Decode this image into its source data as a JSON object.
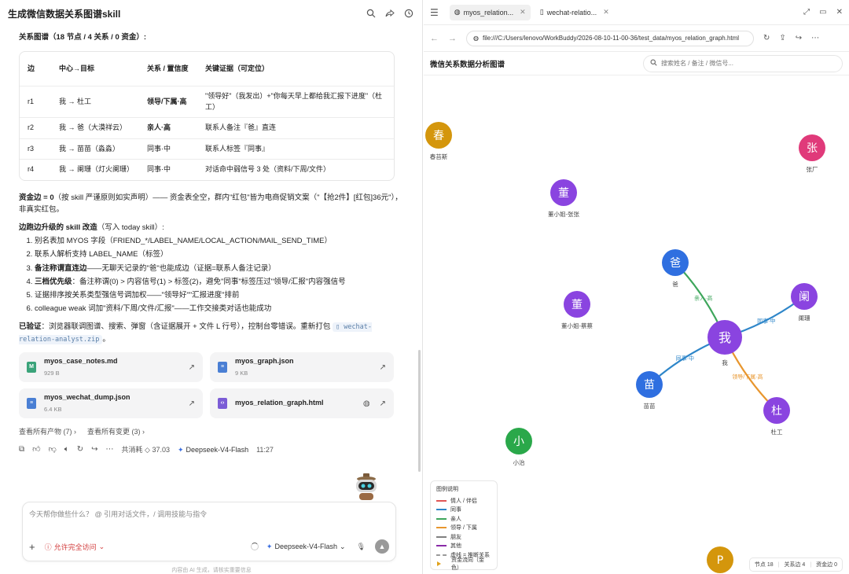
{
  "left": {
    "title": "生成微信数据关系图谱skill",
    "section_heading": "关系图谱（18 节点 / 4 关系 / 0 资金）:",
    "table": {
      "headers": [
        "边",
        "中心→目标",
        "关系 / 置信度",
        "关键证据（可定位）"
      ],
      "rows": [
        {
          "edge": "r1",
          "target": "我 → 杜工",
          "relation": "领导/下属·高",
          "evidence": "\"领导好\"（我发出）+\"你每天早上都给我汇报下进度\"（杜工）"
        },
        {
          "edge": "r2",
          "target": "我 → 爸（大漠祥云）",
          "relation": "亲人·高",
          "evidence": "联系人备注『爸』直连"
        },
        {
          "edge": "r3",
          "target": "我 → 苗苗（淼淼）",
          "relation": "同事·中",
          "evidence": "联系人标签『同事』"
        },
        {
          "edge": "r4",
          "target": "我 → 阑珊（灯火阑珊）",
          "relation": "同事·中",
          "evidence": "对话命中弱信号 3 处（资料/下周/文件）"
        }
      ]
    },
    "fund_para_bold": "资金边 = 0",
    "fund_para_rest": "（按 skill 严谨原则如实声明）—— 资金表全空，群内\"红包\"皆为电商促销文案（\"【抢2件】[红包]36元\"），非真实红包。",
    "upgrade_heading": "边跑边升级的 skill 改造",
    "upgrade_heading_rest": "（写入 today skill）:",
    "steps": [
      {
        "bold": "",
        "text": "别名表加 MYOS 字段（FRIEND_*/LABEL_NAME/LOCAL_ACTION/MAIL_SEND_TIME）"
      },
      {
        "bold": "",
        "text": "联系人解析支持 LABEL_NAME（标签）"
      },
      {
        "bold": "备注称谓直连边",
        "text": "——无聊天记录的\"爸\"也能成边（证据=联系人备注记录）"
      },
      {
        "bold": "三档优先级",
        "text": "：备注称谓(0) > 内容信号(1) > 标签(2)，避免\"同事\"标签压过\"领导/汇报\"内容强信号"
      },
      {
        "bold": "",
        "text": "证据排序按关系类型强信号调加权——\"领导好\"\"汇报进度\"排前"
      },
      {
        "bold": "",
        "text": "colleague weak 词加\"资料/下周/文件/汇报\"——工作交接类对话也能成功"
      }
    ],
    "verified_bold": "已验证",
    "verified_rest": "：浏览器联调图谱、搜索、弹窗（含证据展开 + 文件 L 行号），控制台零错误。重新打包",
    "zip_name": "wechat-relation-analyst.zip",
    "zip_tail": "。",
    "files": [
      {
        "name": "myos_case_notes.md",
        "size": "929 B",
        "icon_label": "M",
        "icon_color": "#3aa37a"
      },
      {
        "name": "myos_graph.json",
        "size": "9 KB",
        "icon_label": "",
        "icon_color": "#4a7fd4"
      },
      {
        "name": "myos_wechat_dump.json",
        "size": "6.4 KB",
        "icon_label": "",
        "icon_color": "#4a7fd4"
      },
      {
        "name": "myos_relation_graph.html",
        "size": "",
        "icon_label": "‹›",
        "icon_color": "#7b5cd6"
      }
    ],
    "links": {
      "all_outputs": "查看所有产物 (7)",
      "all_changes": "查看所有变更 (3)"
    },
    "meta": {
      "cost": "共消耗 ◇ 37.03",
      "model": "Deepseek-V4-Flash",
      "time": "11:27"
    },
    "composer": {
      "placeholder": "今天帮你做些什么？ @ 引用对话文件，/ 调用技能与指令",
      "allow": "允许完全访问",
      "model": "Deepseek-V4-Flash"
    },
    "disclaimer": "内容由 AI 生成，请核实重要信息"
  },
  "right": {
    "tabs": [
      {
        "label": "myos_relation...",
        "active": true
      },
      {
        "label": "wechat-relatio...",
        "active": false
      }
    ],
    "url": "file:///C:/Users/lenovo/WorkBuddy/2026-08-10-11-00-36/test_data/myos_relation_graph.html",
    "page_title": "微信关系数据分析图谱",
    "search_placeholder": "搜索姓名 / 备注 / 微信号...",
    "legend": {
      "title": "图例说明",
      "items": [
        {
          "label": "情人 / 伴侣",
          "color": "#e05656",
          "dash": false
        },
        {
          "label": "同事",
          "color": "#2e86c9",
          "dash": false
        },
        {
          "label": "亲人",
          "color": "#3ea65c",
          "dash": false
        },
        {
          "label": "领导 / 下属",
          "color": "#e8962e",
          "dash": false
        },
        {
          "label": "朋友",
          "color": "#808080",
          "dash": false
        },
        {
          "label": "其他",
          "color": "#8a2ba8",
          "dash": false
        },
        {
          "label": "虚线 = 推断关系",
          "color": "#9a9a9a",
          "dash": true
        }
      ],
      "fund_label": "资金流向（金色）"
    },
    "stats": {
      "nodes": "节点 18",
      "rels": "关系边 4",
      "funds": "资金边 0"
    },
    "graph": {
      "nodes": [
        {
          "id": "chun",
          "char": "春",
          "label": "春苔斯",
          "color": "#d4960c"
        },
        {
          "id": "zhang",
          "char": "张",
          "label": "张厂",
          "color": "#e03a7a"
        },
        {
          "id": "dong1",
          "char": "董",
          "label": "董小姐-张张",
          "color": "#8a44e0"
        },
        {
          "id": "ba",
          "char": "爸",
          "label": "爸",
          "color": "#2f6fe0"
        },
        {
          "id": "lan",
          "char": "阑",
          "label": "阑珊",
          "color": "#8a44e0"
        },
        {
          "id": "dong2",
          "char": "董",
          "label": "董小姐-蔡蔡",
          "color": "#8a44e0"
        },
        {
          "id": "wo",
          "char": "我",
          "label": "我",
          "color": "#8a44e0"
        },
        {
          "id": "miao",
          "char": "苗",
          "label": "苗苗",
          "color": "#2f6fe0"
        },
        {
          "id": "du",
          "char": "杜",
          "label": "杜工",
          "color": "#8a44e0"
        },
        {
          "id": "xiao",
          "char": "小",
          "label": "小治",
          "color": "#2aa84a"
        },
        {
          "id": "p",
          "char": "P",
          "label": "",
          "color": "#d4960c"
        }
      ],
      "edges": [
        {
          "from": "wo",
          "to": "ba",
          "label": "亲人·高",
          "color": "#3ea65c"
        },
        {
          "from": "wo",
          "to": "lan",
          "label": "同事·中",
          "color": "#2e86c9"
        },
        {
          "from": "wo",
          "to": "miao",
          "label": "同事·中",
          "color": "#2e86c9"
        },
        {
          "from": "wo",
          "to": "du",
          "label": "领导/下属·高",
          "color": "#e8962e"
        }
      ]
    }
  }
}
